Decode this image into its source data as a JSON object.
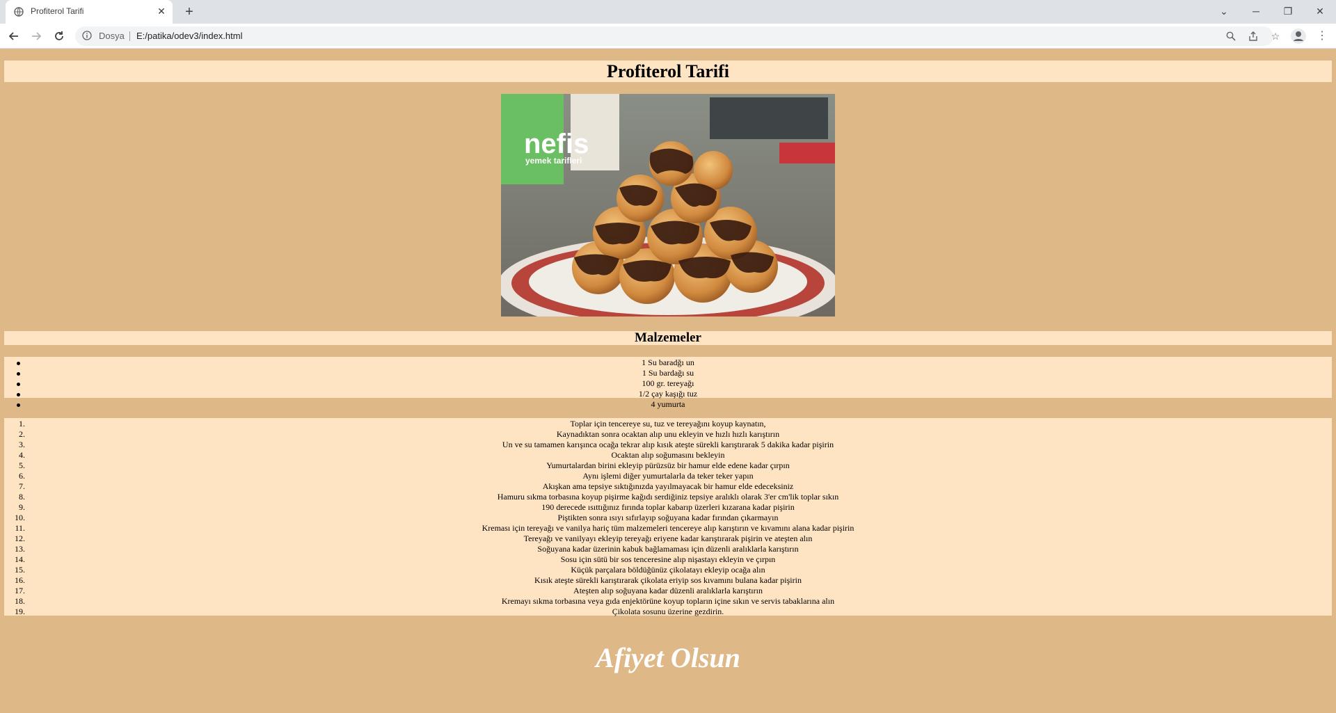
{
  "browser": {
    "tab_title": "Profiterol Tarifi",
    "new_tab_symbol": "+",
    "site_label": "Dosya",
    "url": "E:/patika/odev3/index.html"
  },
  "page": {
    "title": "Profiterol Tarifi",
    "image": {
      "brand_name": "nefis",
      "brand_sub": "yemek tarifleri"
    },
    "ingredients_heading": "Malzemeler",
    "ingredients": [
      "1 Su baradğı un",
      "1 Su bardağı su",
      "100 gr. tereyağı",
      "1/2 çay kaşığı tuz",
      "4 yumurta"
    ],
    "steps": [
      "Toplar için tencereye su, tuz ve tereyağını koyup kaynatın,",
      "Kaynadıktan sonra ocaktan alıp unu ekleyin ve hızlı hızlı karıştırın",
      "Un ve su tamamen karışınca ocağa tekrar alıp kısık ateşte sürekli karıştırarak 5 dakika kadar pişirin",
      "Ocaktan alıp soğumasını bekleyin",
      "Yumurtalardan birini ekleyip pürüzsüz bir hamur elde edene kadar çırpın",
      "Aynı işlemi diğer yumurtalarla da teker teker yapın",
      "Akışkan ama tepsiye sıktığınızda yayılmayacak bir hamur elde edeceksiniz",
      "Hamuru sıkma torbasına koyup pişirme kağıdı serdiğiniz tepsiye aralıklı olarak 3'er cm'lik toplar sıkın",
      "190 derecede ısıttığınız fırında toplar kabarıp üzerleri kızarana kadar pişirin",
      "Piştikten sonra ısıyı sıfırlayıp soğuyana kadar fırından çıkarmayın",
      "Kreması için tereyağı ve vanilya hariç tüm malzemeleri tencereye alıp karıştırın ve kıvamını alana kadar pişirin",
      "Tereyağı ve vanilyayı ekleyip tereyağı eriyene kadar karıştırarak pişirin ve ateşten alın",
      "Soğuyana kadar üzerinin kabuk bağlamaması için düzenli aralıklarla karıştırın",
      "Sosu için sütü bir sos tenceresine alıp nişastayı ekleyin ve çırpın",
      "Küçük parçalara böldüğünüz çikolatayı ekleyip ocağa alın",
      "Kısık ateşte sürekli karıştırarak çikolata eriyip sos kıvamını bulana kadar pişirin",
      "Ateşten alıp soğuyana kadar düzenli aralıklarla karıştırın",
      "Kremayı sıkma torbasına veya gıda enjektörüne koyup topların içine sıkın ve servis tabaklarına alın",
      "Çikolata sosunu üzerine gezdirin."
    ],
    "footer": "Afiyet Olsun"
  },
  "colors": {
    "page_bg": "#deb887",
    "band_bg": "#ffe4c4",
    "footer_text": "#ffffff"
  }
}
